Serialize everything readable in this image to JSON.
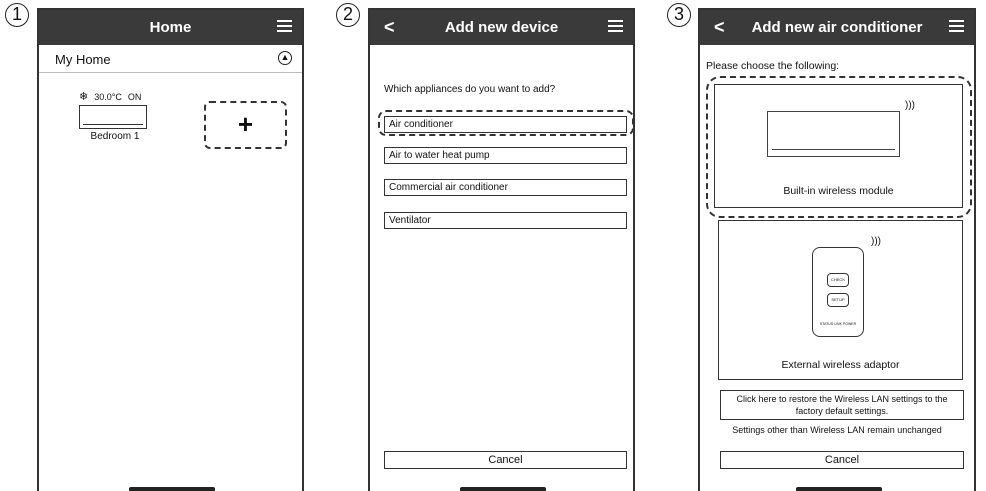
{
  "steps": [
    "1",
    "2",
    "3"
  ],
  "screen1": {
    "title": "Home",
    "menu_icon": "hamburger-icon",
    "section": "My Home",
    "device": {
      "temperature": "30.0°C",
      "power": "ON",
      "name": "Bedroom 1"
    },
    "add_symbol": "+"
  },
  "screen2": {
    "title": "Add new device",
    "back_symbol": "<",
    "question": "Which appliances do you want to add?",
    "options": [
      "Air conditioner",
      "Air to water heat pump",
      "Commercial air conditioner",
      "Ventilator"
    ],
    "cancel": "Cancel"
  },
  "screen3": {
    "title": "Add new air conditioner",
    "back_symbol": "<",
    "prompt": "Please choose the following:",
    "option_builtin": "Built-in wireless module",
    "option_external": "External wireless adaptor",
    "adaptor_buttons": [
      "CHECK",
      "SETUP"
    ],
    "adaptor_leds": "STATUS  LINK  POWER",
    "restore": "Click here to restore the Wireless LAN settings to the factory default settings.",
    "note": "Settings other than Wireless LAN remain unchanged",
    "cancel": "Cancel"
  }
}
